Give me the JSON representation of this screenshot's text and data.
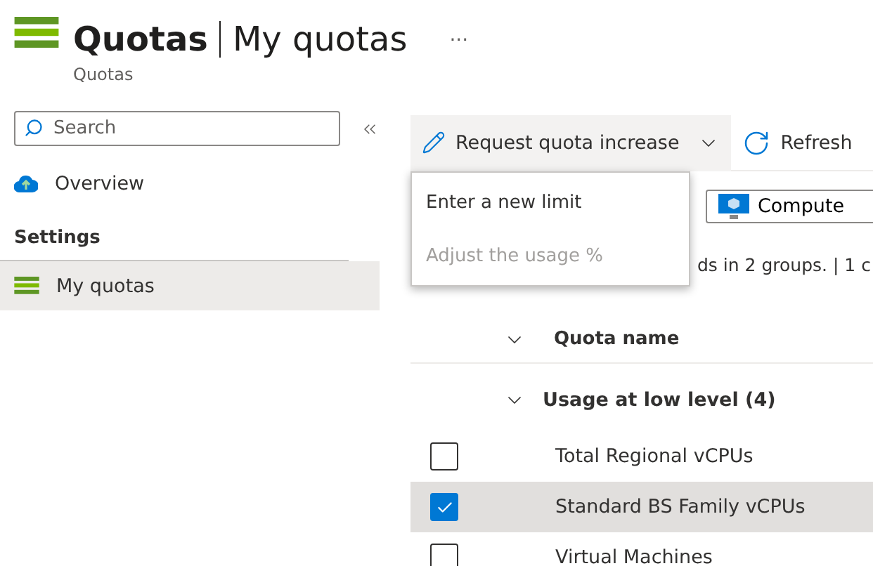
{
  "header": {
    "title": "Quotas",
    "page": "My quotas",
    "more": "···",
    "subtitle": "Quotas"
  },
  "sidebar": {
    "search": {
      "placeholder": "Search"
    },
    "items": [
      {
        "label": "Overview",
        "kind": "overview",
        "selected": false
      }
    ],
    "section": "Settings",
    "section_items": [
      {
        "label": "My quotas",
        "kind": "quotas",
        "selected": true
      }
    ]
  },
  "toolbar": [
    {
      "label": "Request quota increase",
      "kind": "menu",
      "expanded": true
    },
    {
      "label": "Refresh",
      "kind": "refresh"
    }
  ],
  "menu": [
    {
      "label": "Enter a new limit",
      "disabled": false
    },
    {
      "label": "Adjust the usage %",
      "disabled": true
    }
  ],
  "filter": {
    "label": "Compute"
  },
  "summary": "ds in 2 groups. | 1 c",
  "table": {
    "column": "Quota name",
    "group": {
      "label": "Usage at low level (4)",
      "expanded": true
    },
    "rows": [
      {
        "name": "Total Regional vCPUs",
        "checked": false,
        "selected": false
      },
      {
        "name": "Standard BS Family vCPUs",
        "checked": true,
        "selected": true
      },
      {
        "name": "Virtual Machines",
        "checked": false,
        "selected": false
      }
    ]
  }
}
